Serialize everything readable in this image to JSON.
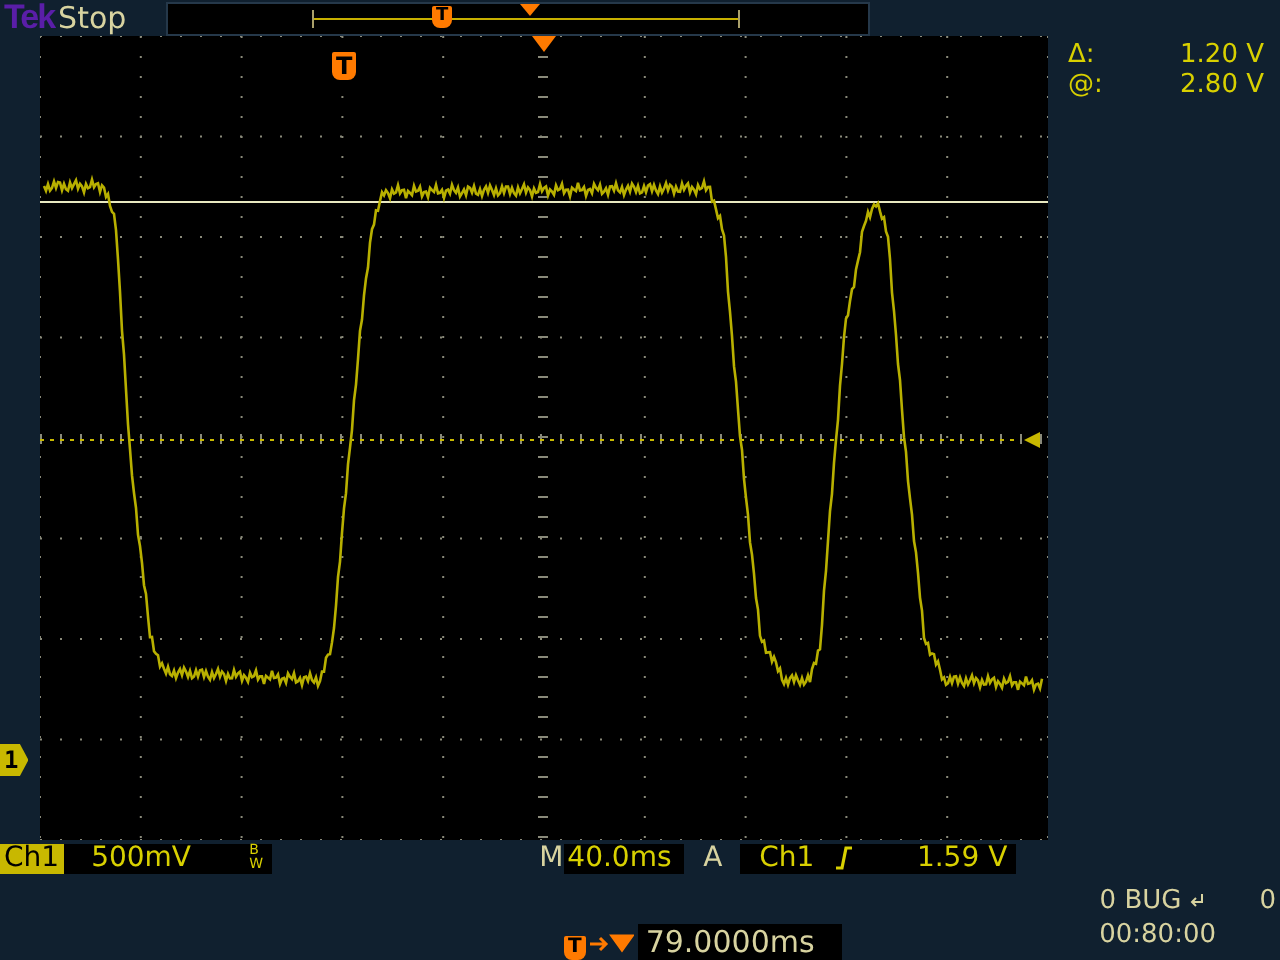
{
  "header": {
    "brand": "Tek",
    "status": "Stop",
    "record_trigger_label": "T"
  },
  "screen": {
    "trigger_label": "T",
    "ground_label": "1"
  },
  "cursor_readouts": [
    {
      "symbol": "Δ:",
      "value": "1.20 V"
    },
    {
      "symbol": "@:",
      "value": "2.80 V"
    }
  ],
  "channel": {
    "name": "Ch1",
    "scale": "500mV",
    "bandwidth": "BW"
  },
  "timebase": {
    "label": "M",
    "value": "40.0ms"
  },
  "trigger": {
    "mode": "A",
    "source": "Ch1",
    "level": "1.59 V"
  },
  "position": {
    "trigger_label": "T",
    "value": "79.0000ms"
  },
  "status": {
    "line_1": "0 BUG",
    "line_1_end": "0",
    "line_2": "00:80:00"
  }
}
